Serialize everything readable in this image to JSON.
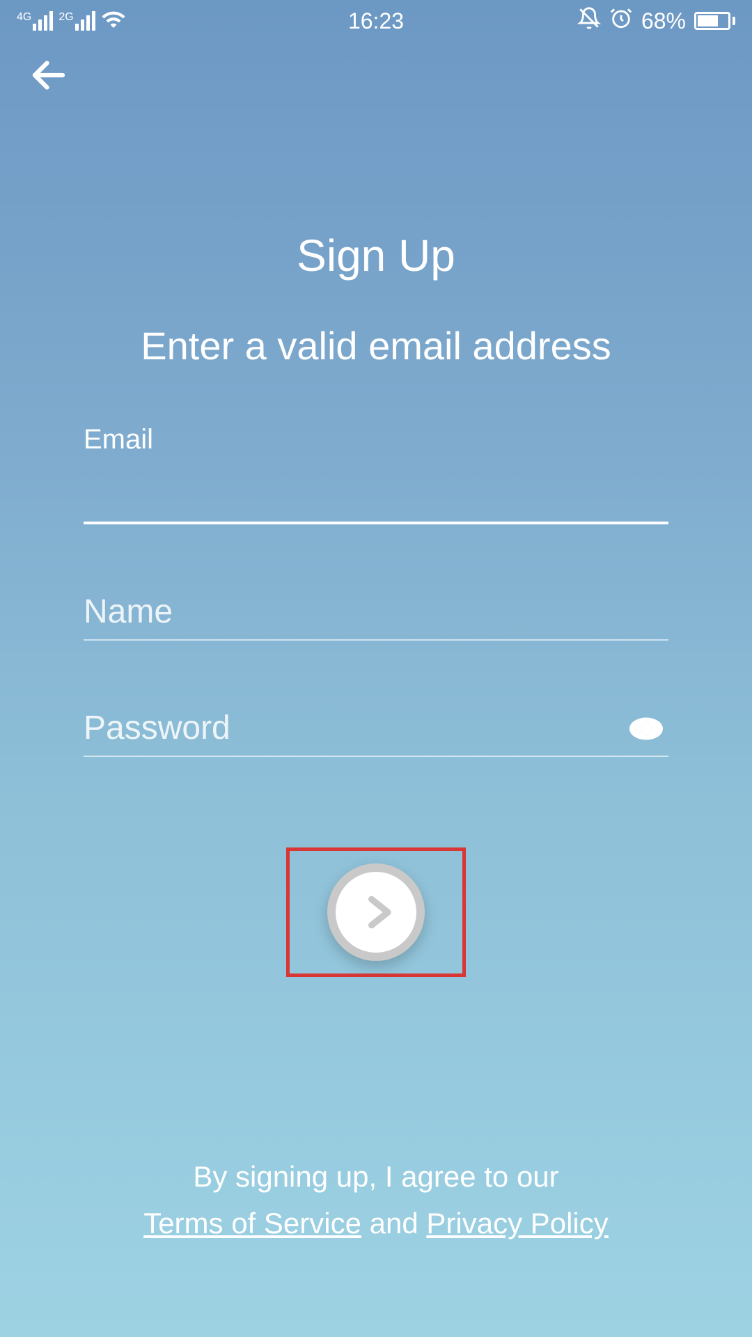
{
  "statusBar": {
    "network1": "4G",
    "network2": "2G",
    "time": "16:23",
    "battery": "68%"
  },
  "page": {
    "title": "Sign Up",
    "subtitle": "Enter a valid email address"
  },
  "form": {
    "emailLabel": "Email",
    "namePlaceholder": "Name",
    "passwordPlaceholder": "Password"
  },
  "footer": {
    "agreeText": "By signing up, I agree to our",
    "termsLink": "Terms of Service",
    "andText": " and ",
    "privacyLink": "Privacy Policy"
  }
}
